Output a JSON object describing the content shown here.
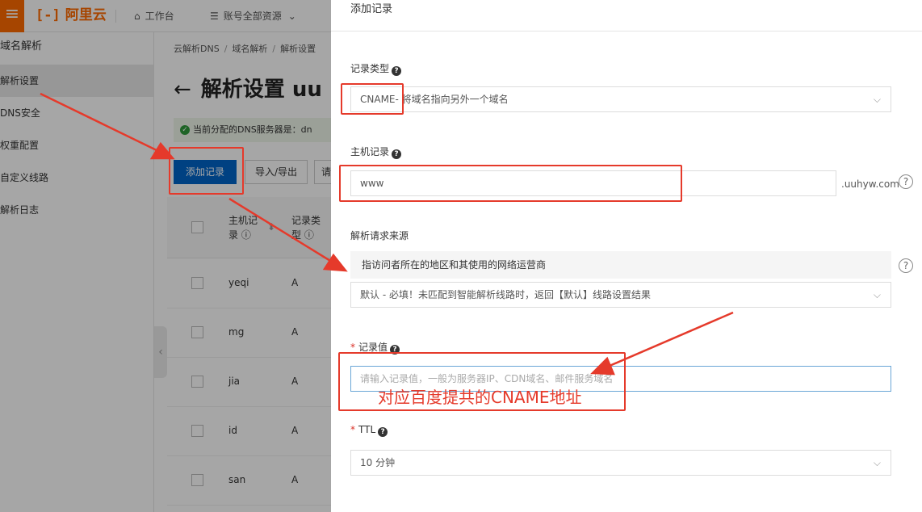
{
  "topbar": {
    "menu_icon": "menu-icon",
    "brand": "阿里云",
    "workbench": "工作台",
    "account_scope": "账号全部资源"
  },
  "sidebar": {
    "title": "域名解析",
    "items": [
      {
        "label": "解析设置",
        "active": true
      },
      {
        "label": "DNS安全"
      },
      {
        "label": "权重配置"
      },
      {
        "label": "自定义线路"
      },
      {
        "label": "解析日志"
      }
    ]
  },
  "main": {
    "breadcrumb": [
      "云解析DNS",
      "域名解析",
      "解析设置"
    ],
    "page_title": "解析设置 uu",
    "notice": "当前分配的DNS服务器是：dn",
    "add_record_label": "添加记录",
    "import_export_label": "导入/导出",
    "more_label": "请",
    "columns": {
      "host_line1": "主机记",
      "host_line2": "录",
      "type_line1": "记录类",
      "type_line2": "型"
    },
    "rows": [
      {
        "host": "yeqi",
        "type": "A"
      },
      {
        "host": "mg",
        "type": "A"
      },
      {
        "host": "jia",
        "type": "A"
      },
      {
        "host": "id",
        "type": "A"
      },
      {
        "host": "san",
        "type": "A"
      }
    ]
  },
  "drawer": {
    "title": "添加记录",
    "record_type": {
      "label": "记录类型",
      "value": "CNAME- 将域名指向另外一个域名"
    },
    "host_record": {
      "label": "主机记录",
      "value": "www",
      "suffix": ".uuhyw.com"
    },
    "source": {
      "label": "解析请求来源",
      "note": "指访问者所在的地区和其使用的网络运营商",
      "value": "默认 - 必填！未匹配到智能解析线路时，返回【默认】线路设置结果"
    },
    "record_value": {
      "label": "记录值",
      "placeholder": "请输入记录值，一般为服务器IP、CDN域名、邮件服务域名"
    },
    "ttl": {
      "label": "TTL",
      "value": "10 分钟"
    }
  },
  "annotation": {
    "text": "对应百度提共的CNAME地址",
    "color": "#e53a2b"
  }
}
